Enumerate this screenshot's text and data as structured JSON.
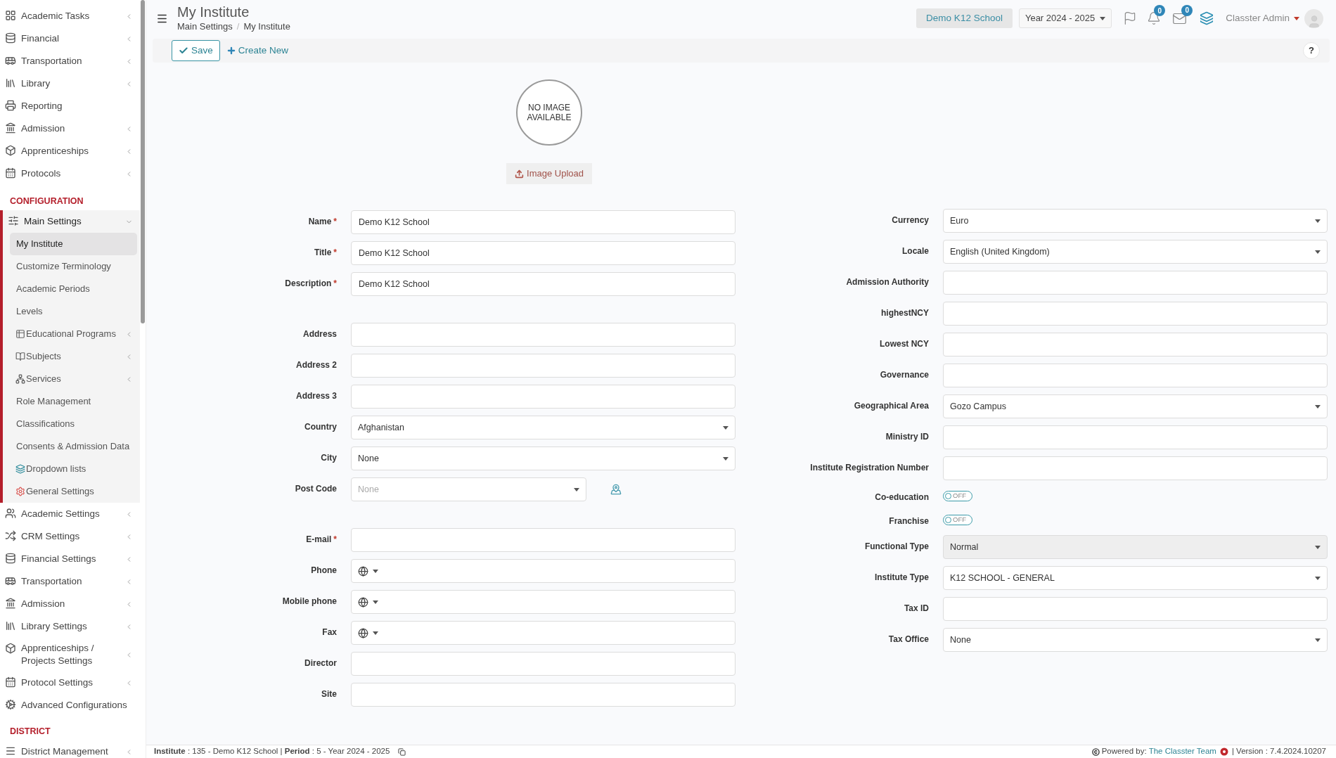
{
  "sidebar": {
    "sections": [
      {
        "items": [
          {
            "label": "Academic Tasks",
            "expanded": false,
            "selected": false
          },
          {
            "label": "Financial",
            "expanded": false,
            "selected": false
          },
          {
            "label": "Transportation",
            "expanded": false,
            "selected": false
          },
          {
            "label": "Library",
            "expanded": false,
            "selected": false
          },
          {
            "label": "Reporting",
            "selected": false
          },
          {
            "label": "Admission",
            "expanded": false,
            "selected": false
          },
          {
            "label": "Apprenticeships",
            "expanded": false,
            "selected": false
          },
          {
            "label": "Protocols",
            "expanded": false,
            "selected": false
          }
        ]
      },
      {
        "heading": "CONFIGURATION",
        "items": [
          {
            "label": "Main Settings",
            "expanded": true,
            "selected": false,
            "children": [
              {
                "label": "My Institute",
                "selected": true
              },
              {
                "label": "Customize Terminology",
                "selected": false
              },
              {
                "label": "Academic Periods",
                "selected": false
              },
              {
                "label": "Levels",
                "selected": false
              },
              {
                "label": "Educational Programs",
                "expanded": false,
                "selected": false
              },
              {
                "label": "Subjects",
                "expanded": false,
                "selected": false
              },
              {
                "label": "Services",
                "expanded": false,
                "selected": false
              },
              {
                "label": "Role Management",
                "selected": false
              },
              {
                "label": "Classifications",
                "selected": false
              },
              {
                "label": "Consents & Admission Data",
                "selected": false
              },
              {
                "label": "Dropdown lists",
                "selected": false
              },
              {
                "label": "General Settings",
                "selected": false
              }
            ]
          },
          {
            "label": "Academic Settings",
            "expanded": false,
            "selected": false
          },
          {
            "label": "CRM Settings",
            "expanded": false,
            "selected": false
          },
          {
            "label": "Financial Settings",
            "expanded": false,
            "selected": false
          },
          {
            "label": "Transportation",
            "expanded": false,
            "selected": false
          },
          {
            "label": "Admission",
            "expanded": false,
            "selected": false
          },
          {
            "label": "Library Settings",
            "expanded": false,
            "selected": false
          },
          {
            "label": "Apprenticeships / Projects Settings",
            "expanded": false,
            "selected": false
          },
          {
            "label": "Protocol Settings",
            "expanded": false,
            "selected": false
          },
          {
            "label": "Advanced Configurations",
            "selected": false
          }
        ]
      },
      {
        "heading": "DISTRICT",
        "items": [
          {
            "label": "District Management",
            "expanded": false,
            "selected": false
          }
        ]
      }
    ]
  },
  "header": {
    "title": "My Institute",
    "breadcrumb": [
      "Main Settings",
      "My Institute"
    ],
    "breadcrumb_separator": "/",
    "institute_button": "Demo K12 School",
    "year_select": "Year 2024 - 2025",
    "notifications_count": "0",
    "messages_count": "0",
    "user_name": "Classter Admin"
  },
  "toolbar": {
    "buttons": [
      {
        "label": "Save",
        "kind": "outlined"
      },
      {
        "label": "Create New",
        "kind": "link"
      }
    ],
    "help": "?"
  },
  "photo": {
    "placeholder_text": "NO IMAGE AVAILABLE",
    "upload_button": "Image Upload"
  },
  "form": {
    "required_mark": "*",
    "left_groups": [
      [
        {
          "label": "Name",
          "required": true,
          "kind": "text",
          "value": "Demo K12 School",
          "disabled": false
        },
        {
          "label": "Title",
          "required": true,
          "kind": "text",
          "value": "Demo K12 School",
          "disabled": false
        },
        {
          "label": "Description",
          "required": true,
          "kind": "text",
          "value": "Demo K12 School",
          "disabled": false
        }
      ],
      [
        {
          "label": "Address",
          "required": false,
          "kind": "text",
          "disabled": false
        },
        {
          "label": "Address 2",
          "required": false,
          "kind": "text",
          "disabled": false
        },
        {
          "label": "Address 3",
          "required": false,
          "kind": "text",
          "disabled": false
        },
        {
          "label": "Country",
          "required": false,
          "kind": "select",
          "value": "Afghanistan",
          "disabled": false
        },
        {
          "label": "City",
          "required": false,
          "kind": "select",
          "value": "None",
          "disabled": false
        },
        {
          "label": "Post Code",
          "required": false,
          "kind": "select-map",
          "placeholder": "None",
          "disabled": false
        }
      ],
      [
        {
          "label": "E-mail",
          "required": true,
          "kind": "text",
          "disabled": false
        },
        {
          "label": "Phone",
          "required": false,
          "kind": "phone",
          "disabled": false
        },
        {
          "label": "Mobile phone",
          "required": false,
          "kind": "phone",
          "disabled": false
        },
        {
          "label": "Fax",
          "required": false,
          "kind": "phone",
          "disabled": false
        },
        {
          "label": "Director",
          "required": false,
          "kind": "text",
          "disabled": false
        },
        {
          "label": "Site",
          "required": false,
          "kind": "text",
          "disabled": false
        }
      ]
    ],
    "right_fields": [
      {
        "label": "Currency",
        "required": false,
        "kind": "select",
        "value": "Euro",
        "disabled": false
      },
      {
        "label": "Locale",
        "required": false,
        "kind": "select",
        "value": "English (United Kingdom)",
        "disabled": false
      },
      {
        "label": "Admission Authority",
        "required": false,
        "kind": "text",
        "disabled": false
      },
      {
        "label": "highestNCY",
        "required": false,
        "kind": "text",
        "disabled": false
      },
      {
        "label": "Lowest NCY",
        "required": false,
        "kind": "text",
        "disabled": false
      },
      {
        "label": "Governance",
        "required": false,
        "kind": "text",
        "disabled": false
      },
      {
        "label": "Geographical Area",
        "required": false,
        "kind": "select",
        "value": "Gozo Campus",
        "disabled": false
      },
      {
        "label": "Ministry ID",
        "required": false,
        "kind": "text",
        "disabled": false
      },
      {
        "label": "Institute Registration Number",
        "required": false,
        "kind": "text",
        "disabled": false
      },
      {
        "label": "Co-education",
        "required": false,
        "kind": "toggle",
        "on": false,
        "text": "OFF"
      },
      {
        "label": "Franchise",
        "required": false,
        "kind": "toggle",
        "on": false,
        "text": "OFF"
      },
      {
        "label": "Functional Type",
        "required": false,
        "kind": "select",
        "value": "Normal",
        "disabled": true
      },
      {
        "label": "Institute Type",
        "required": false,
        "kind": "select",
        "value": "K12 SCHOOL - GENERAL",
        "disabled": false
      },
      {
        "label": "Tax ID",
        "required": false,
        "kind": "text",
        "disabled": false
      },
      {
        "label": "Tax Office",
        "required": false,
        "kind": "select",
        "value": "None",
        "disabled": false
      }
    ]
  },
  "footer": {
    "context": "**Institute** : 135 - Demo K12 School | **Period** : 5 - Year 2024 - 2025",
    "powered_by": "Powered by:",
    "team_link": "The Classter Team",
    "version": "| Version : 7.4.2024.10207"
  }
}
